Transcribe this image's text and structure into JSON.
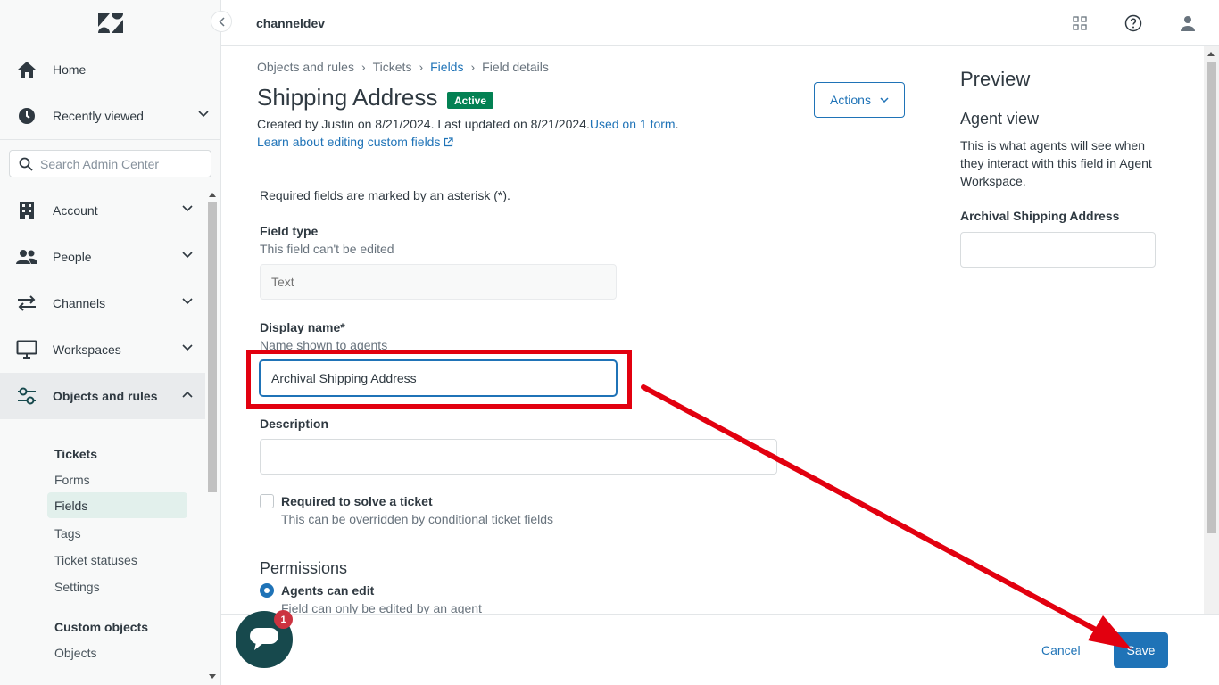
{
  "topbar": {
    "account_name": "channeldev"
  },
  "sidebar": {
    "nav": [
      {
        "label": "Home"
      },
      {
        "label": "Recently viewed"
      },
      {
        "label": "Account"
      },
      {
        "label": "People"
      },
      {
        "label": "Channels"
      },
      {
        "label": "Workspaces"
      },
      {
        "label": "Objects and rules"
      }
    ],
    "search_placeholder": "Search Admin Center",
    "tickets_heading": "Tickets",
    "ticket_links": [
      "Forms",
      "Fields",
      "Tags",
      "Ticket statuses",
      "Settings"
    ],
    "custom_heading": "Custom objects",
    "custom_links": [
      "Objects"
    ]
  },
  "breadcrumb": [
    "Objects and rules",
    "Tickets",
    "Fields",
    "Field details"
  ],
  "page": {
    "title": "Shipping Address",
    "status_badge": "Active",
    "meta": "Created by Justin on 8/21/2024. Last updated on 8/21/2024.",
    "used_on": "Used on 1 form",
    "meta_period": ".",
    "learn_link": "Learn about editing custom fields",
    "actions_label": "Actions"
  },
  "form": {
    "required_note": "Required fields are marked by an asterisk (*).",
    "field_type_label": "Field type",
    "field_type_hint": "This field can't be edited",
    "field_type_value": "Text",
    "display_name_label": "Display name*",
    "display_name_hint": "Name shown to agents",
    "display_name_value": "Archival Shipping Address",
    "description_label": "Description",
    "description_value": "",
    "required_label": "Required to solve a ticket",
    "required_hint": "This can be overridden by conditional ticket fields",
    "permissions_heading": "Permissions",
    "perm_option_label": "Agents can edit",
    "perm_option_hint": "Field can only be edited by an agent"
  },
  "preview": {
    "title": "Preview",
    "subtitle": "Agent view",
    "description": "This is what agents will see when they interact with this field in Agent Workspace.",
    "field_label": "Archival Shipping Address"
  },
  "footer": {
    "cancel_label": "Cancel",
    "save_label": "Save"
  },
  "chat": {
    "badge_count": "1"
  },
  "colors": {
    "accent": "#1f73b7",
    "active_badge": "#038153",
    "annotation_red": "#e2000f",
    "chat_bg": "#17494d"
  }
}
